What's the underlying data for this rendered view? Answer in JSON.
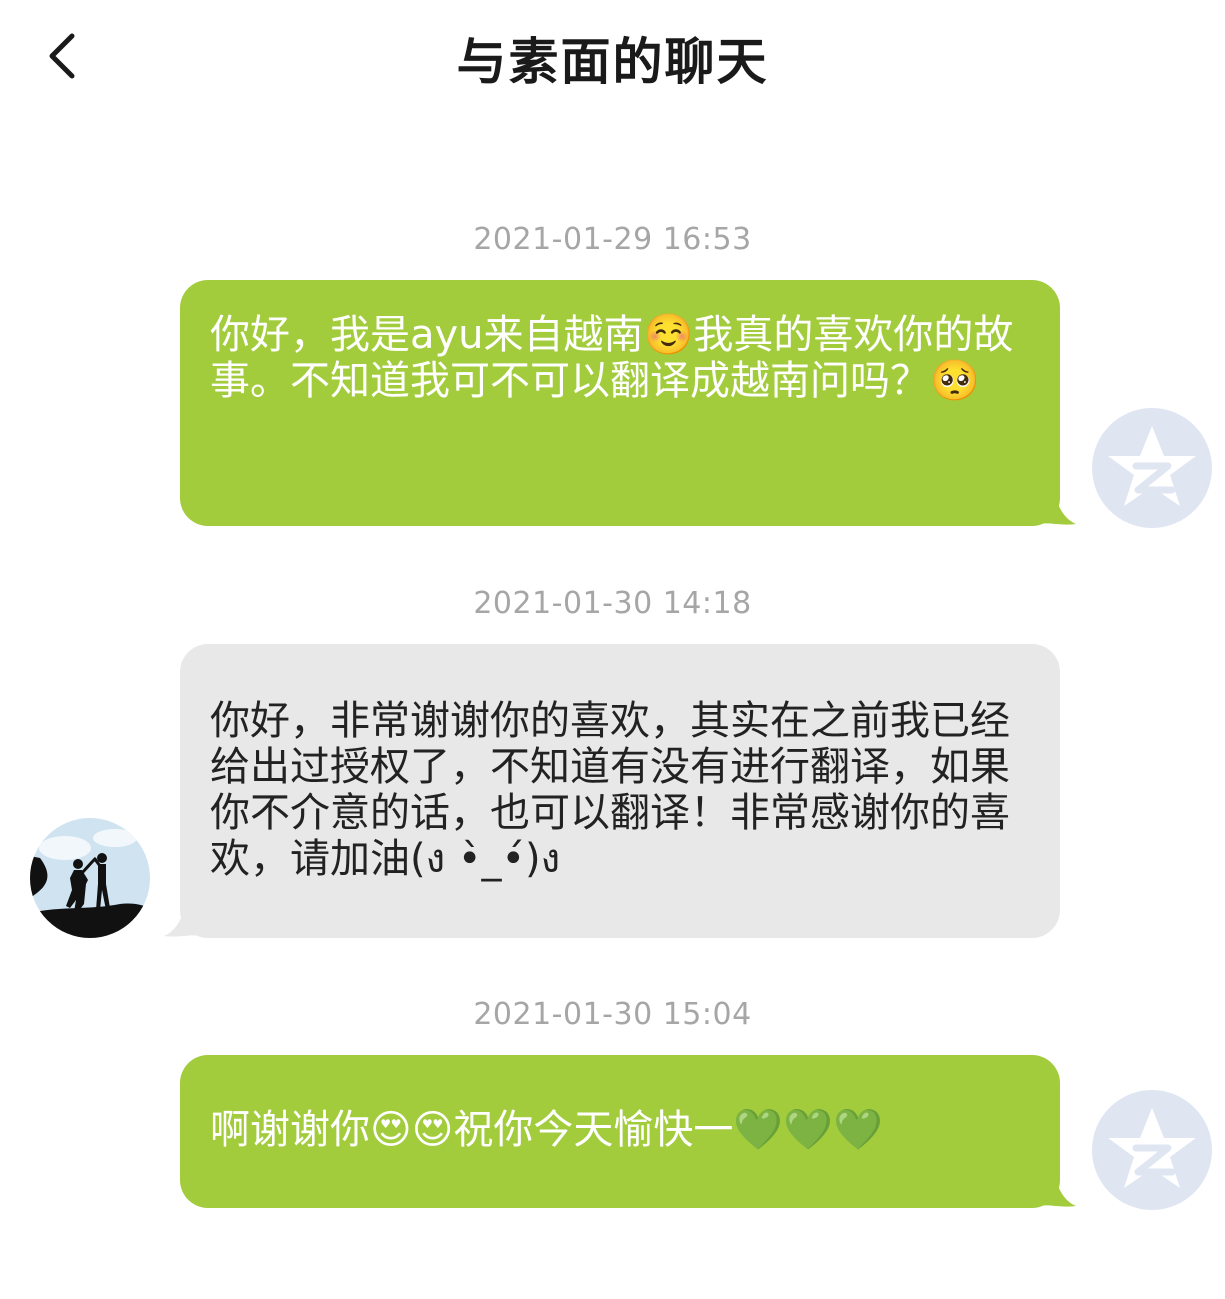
{
  "header": {
    "title": "与素面的聊天"
  },
  "messages": [
    {
      "timestamp": "2021-01-29 16:53",
      "side": "right",
      "text": "你好，我是ayu来自越南☺️我真的喜欢你的故事。不知道我可不可以翻译成越南问吗？🥺",
      "avatar": "qzone-star-icon"
    },
    {
      "timestamp": "2021-01-30 14:18",
      "side": "left",
      "text": "你好，非常谢谢你的喜欢，其实在之前我已经给出过授权了，不知道有没有进行翻译，如果你不介意的话，也可以翻译！非常感谢你的喜欢，请加油(ง •̀_•́)ง",
      "avatar": "silhouette-couple-avatar"
    },
    {
      "timestamp": "2021-01-30 15:04",
      "side": "right",
      "text": "啊谢谢你😍😍祝你今天愉快一💚💚💚",
      "avatar": "qzone-star-icon"
    }
  ],
  "colors": {
    "sent_bubble": "#a2cc3c",
    "received_bubble": "#e8e8e8",
    "timestamp": "#a6a6a6",
    "avatar_placeholder": "#dfe6f2"
  }
}
